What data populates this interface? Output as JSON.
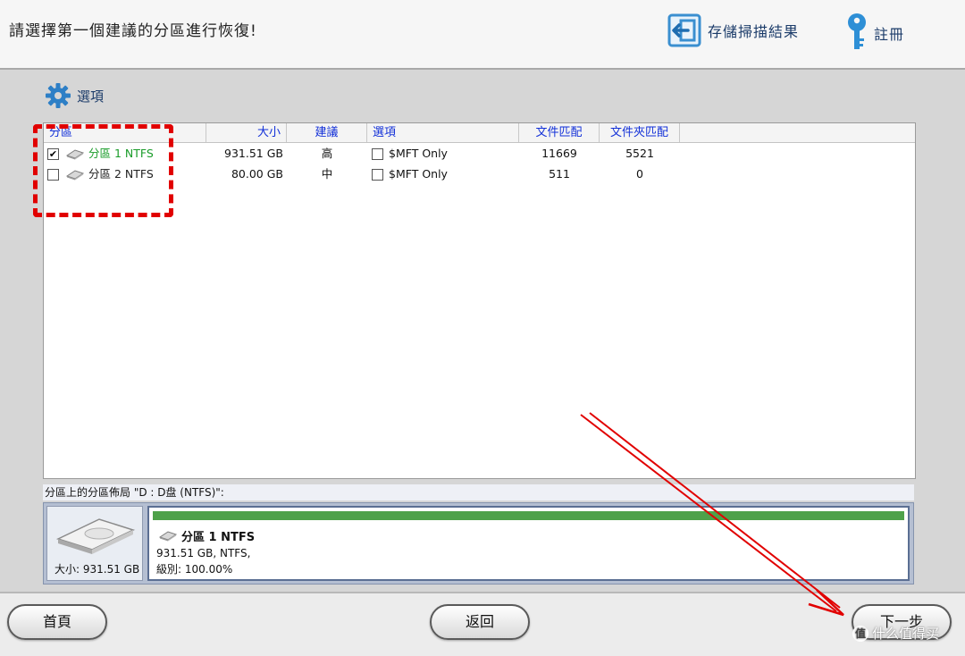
{
  "header": {
    "title": "請選擇第一個建議的分區進行恢復!",
    "save_results_label": "存儲掃描結果",
    "register_label": "註冊"
  },
  "toolbar": {
    "options_label": "選項"
  },
  "table": {
    "columns": [
      "分區",
      "大小",
      "建議",
      "選項",
      "文件匹配",
      "文件夾匹配"
    ],
    "rows": [
      {
        "checked": true,
        "name": "分區 1 NTFS",
        "size": "931.51 GB",
        "suggestion": "高",
        "option_checked": false,
        "option": "$MFT Only",
        "file_match": "11669",
        "folder_match": "5521",
        "selected": true
      },
      {
        "checked": false,
        "name": "分區 2 NTFS",
        "size": "80.00 GB",
        "suggestion": "中",
        "option_checked": false,
        "option": "$MFT Only",
        "file_match": "511",
        "folder_match": "0",
        "selected": false
      }
    ]
  },
  "layout": {
    "caption": "分區上的分區佈局 \"D : D盘 (NTFS)\":",
    "disk_size": "大小: 931.51 GB",
    "partition_title": "分區 1 NTFS",
    "partition_line1": "931.51 GB, NTFS,",
    "partition_line2": "級別: 100.00%",
    "usage_fraction": 1.0
  },
  "footer": {
    "home_label": "首頁",
    "back_label": "返回",
    "next_label": "下一步"
  },
  "colors": {
    "accent_blue": "#1230d8",
    "selected_green": "#1a9c2a",
    "annotation_red": "#e10000",
    "usage_green": "#4ea14a"
  },
  "watermark": "值 什么值得买"
}
